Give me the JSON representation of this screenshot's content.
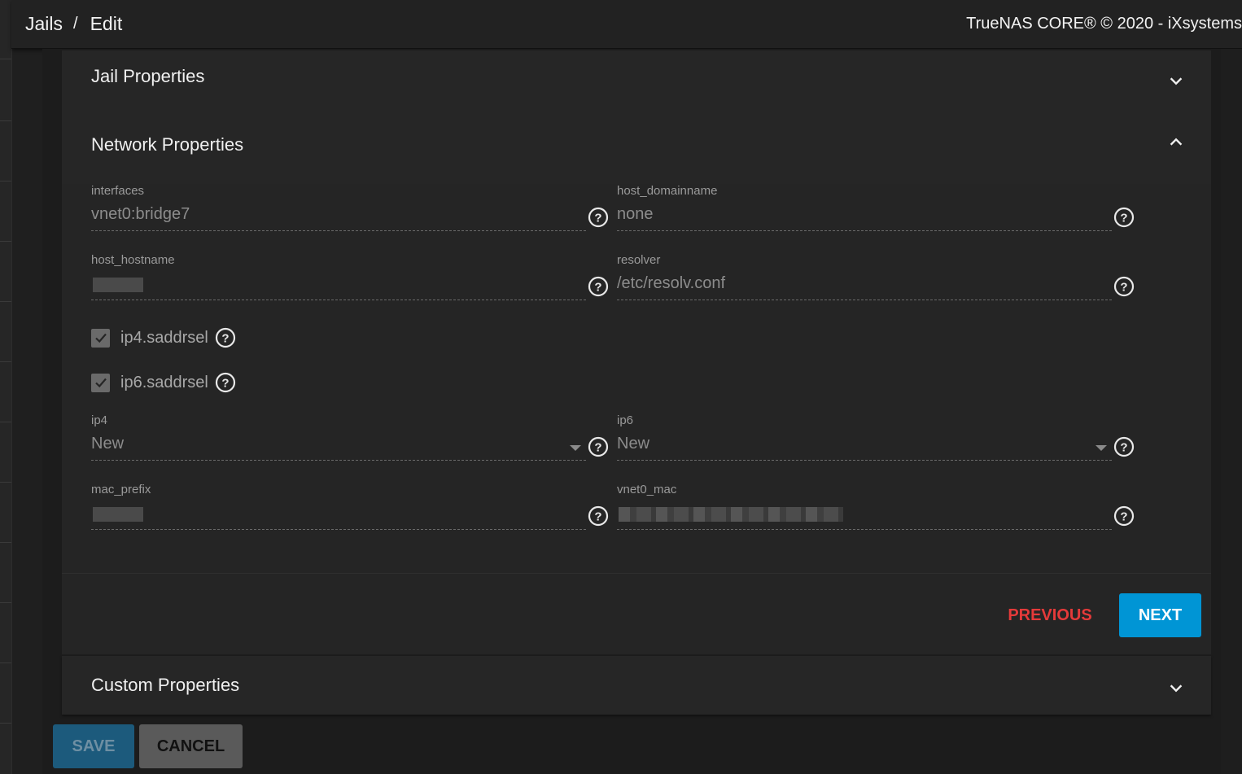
{
  "header": {
    "breadcrumb": [
      "Jails",
      "Edit"
    ],
    "separator": "/",
    "brand": "TrueNAS CORE® © 2020 - iXsystems"
  },
  "sections": {
    "jail_properties": {
      "title": "Jail Properties",
      "icon": "chevron-down-icon"
    },
    "network_properties": {
      "title": "Network Properties",
      "icon": "chevron-up-icon"
    },
    "custom_properties": {
      "title": "Custom Properties",
      "icon": "chevron-down-icon"
    }
  },
  "network": {
    "interfaces": {
      "label": "interfaces",
      "value": "vnet0:bridge7"
    },
    "host_domainname": {
      "label": "host_domainname",
      "value": "none"
    },
    "host_hostname": {
      "label": "host_hostname",
      "value": ""
    },
    "resolver": {
      "label": "resolver",
      "value": "/etc/resolv.conf"
    },
    "ip4_saddrsel": {
      "label": "ip4.saddrsel",
      "checked": true
    },
    "ip6_saddrsel": {
      "label": "ip6.saddrsel",
      "checked": true
    },
    "ip4": {
      "label": "ip4",
      "value": "New"
    },
    "ip6": {
      "label": "ip6",
      "value": "New"
    },
    "mac_prefix": {
      "label": "mac_prefix",
      "value": ""
    },
    "vnet0_mac": {
      "label": "vnet0_mac",
      "value": ""
    }
  },
  "actions": {
    "previous": "PREVIOUS",
    "next": "NEXT"
  },
  "form": {
    "save": "SAVE",
    "cancel": "CANCEL"
  },
  "colors": {
    "accent": "#0095d5",
    "danger": "#e53a3a"
  }
}
